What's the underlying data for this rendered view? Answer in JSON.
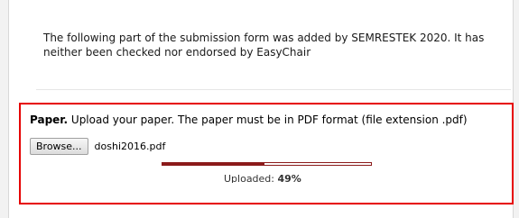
{
  "notice": {
    "text": "The following part of the submission form was added by SEMRESTEK 2020. It has neither been checked nor endorsed by EasyChair"
  },
  "paper": {
    "label": "Paper.",
    "instructions": "Upload your paper. The paper must be in PDF format (file extension .pdf)",
    "browse_button": "Browse...",
    "file_name": "doshi2016.pdf",
    "progress_fraction": 0.49,
    "status_label": "Uploaded:",
    "status_value": "49%"
  },
  "colors": {
    "highlight_border": "#e60000",
    "progress_fill": "#8b1a1a"
  }
}
